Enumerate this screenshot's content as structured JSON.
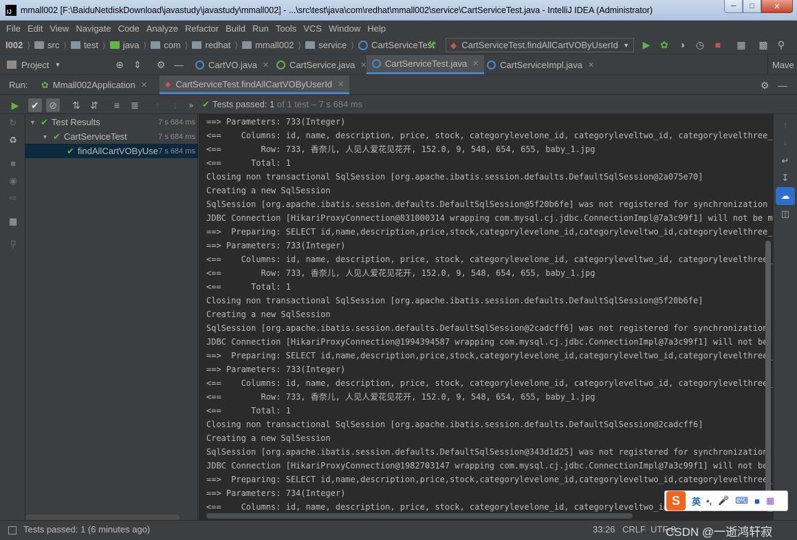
{
  "window": {
    "title": "mmall002 [F:\\BaiduNetdiskDownload\\javastudy\\javastudy\\mmall002] - ...\\src\\test\\java\\com\\redhat\\mmall002\\service\\CartServiceTest.java - IntelliJ IDEA (Administrator)",
    "app_icon_text": "IJ"
  },
  "menu": [
    "File",
    "Edit",
    "View",
    "Navigate",
    "Code",
    "Analyze",
    "Refactor",
    "Build",
    "Run",
    "Tools",
    "VCS",
    "Window",
    "Help"
  ],
  "breadcrumb": {
    "items": [
      "l002",
      "src",
      "test",
      "java",
      "com",
      "redhat",
      "mmall002",
      "service",
      "CartServiceTest"
    ]
  },
  "run_config": "CartServiceTest.findAllCartVOByUserId",
  "editor_tabs": {
    "project_label": "Project",
    "tabs": [
      "CartVO.java",
      "CartService.java",
      "CartServiceTest.java",
      "CartServiceImpl.java"
    ],
    "overflow": "Mave"
  },
  "run": {
    "label": "Run:",
    "tabs": [
      "Mmall002Application",
      "CartServiceTest.findAllCartVOByUserId"
    ],
    "status_prefix": "Tests passed:",
    "status_count": "1",
    "status_suffix": "of 1 test – 7 s 684 ms"
  },
  "tree": {
    "nodes": [
      {
        "label": "Test Results",
        "time": "7 s 684 ms"
      },
      {
        "label": "CartServiceTest",
        "time": "7 s 684 ms"
      },
      {
        "label": "findAllCartVOByUse",
        "time": "7 s 684 ms"
      }
    ]
  },
  "console": {
    "lines": [
      "==> Parameters: 733(Integer)",
      "<==    Columns: id, name, description, price, stock, categorylevelone_id, categoryleveltwo_id, categorylevelthree_id,",
      "<==        Row: 733, 香奈儿, 人见人爱花见花开, 152.0, 9, 548, 654, 655, baby_1.jpg",
      "<==      Total: 1",
      "Closing non transactional SqlSession [org.apache.ibatis.session.defaults.DefaultSqlSession@2a075e70]",
      "Creating a new SqlSession",
      "SqlSession [org.apache.ibatis.session.defaults.DefaultSqlSession@5f20b6fe] was not registered for synchronization beca",
      "JDBC Connection [HikariProxyConnection@831000314 wrapping com.mysql.cj.jdbc.ConnectionImpl@7a3c99f1] will not be manag",
      "==>  Preparing: SELECT id,name,description,price,stock,categorylevelone_id,categoryleveltwo_id,categorylevelthree_id,f",
      "==> Parameters: 733(Integer)",
      "<==    Columns: id, name, description, price, stock, categorylevelone_id, categoryleveltwo_id, categorylevelthree_id,",
      "<==        Row: 733, 香奈儿, 人见人爱花见花开, 152.0, 9, 548, 654, 655, baby_1.jpg",
      "<==      Total: 1",
      "Closing non transactional SqlSession [org.apache.ibatis.session.defaults.DefaultSqlSession@5f20b6fe]",
      "Creating a new SqlSession",
      "SqlSession [org.apache.ibatis.session.defaults.DefaultSqlSession@2cadcff6] was not registered for synchronization beca",
      "JDBC Connection [HikariProxyConnection@1994394587 wrapping com.mysql.cj.jdbc.ConnectionImpl@7a3c99f1] will not be mana",
      "==>  Preparing: SELECT id,name,description,price,stock,categorylevelone_id,categoryleveltwo_id,categorylevelthree_id,f",
      "==> Parameters: 733(Integer)",
      "<==    Columns: id, name, description, price, stock, categorylevelone_id, categoryleveltwo_id, categorylevelthree_id,",
      "<==        Row: 733, 香奈儿, 人见人爱花见花开, 152.0, 9, 548, 654, 655, baby_1.jpg",
      "<==      Total: 1",
      "Closing non transactional SqlSession [org.apache.ibatis.session.defaults.DefaultSqlSession@2cadcff6]",
      "Creating a new SqlSession",
      "SqlSession [org.apache.ibatis.session.defaults.DefaultSqlSession@343d1d25] was not registered for synchronization beca",
      "JDBC Connection [HikariProxyConnection@1982703147 wrapping com.mysql.cj.jdbc.ConnectionImpl@7a3c99f1] will not be mana",
      "==>  Preparing: SELECT id,name,description,price,stock,categorylevelone_id,categoryleveltwo_id,categorylevelthree_id,f",
      "==> Parameters: 734(Integer)",
      "<==    Columns: id, name, description, price, stock, categorylevelone_id, categoryleveltwo_id, categorylevelthree_id,"
    ]
  },
  "statusbar": {
    "message": "Tests passed: 1 (6 minutes ago)",
    "position": "33:26",
    "line_sep": "CRLF",
    "encoding": "UTF-8",
    "watermark": "CSDN @一逝鸿轩寂"
  },
  "ime": {
    "logo": "S",
    "lang": "英"
  },
  "colors": {
    "bg": "#3c3f41",
    "console_bg": "#2b2b2b",
    "pass_green": "#62b543",
    "accent_blue": "#4a88c7",
    "selection": "#0d293e"
  }
}
